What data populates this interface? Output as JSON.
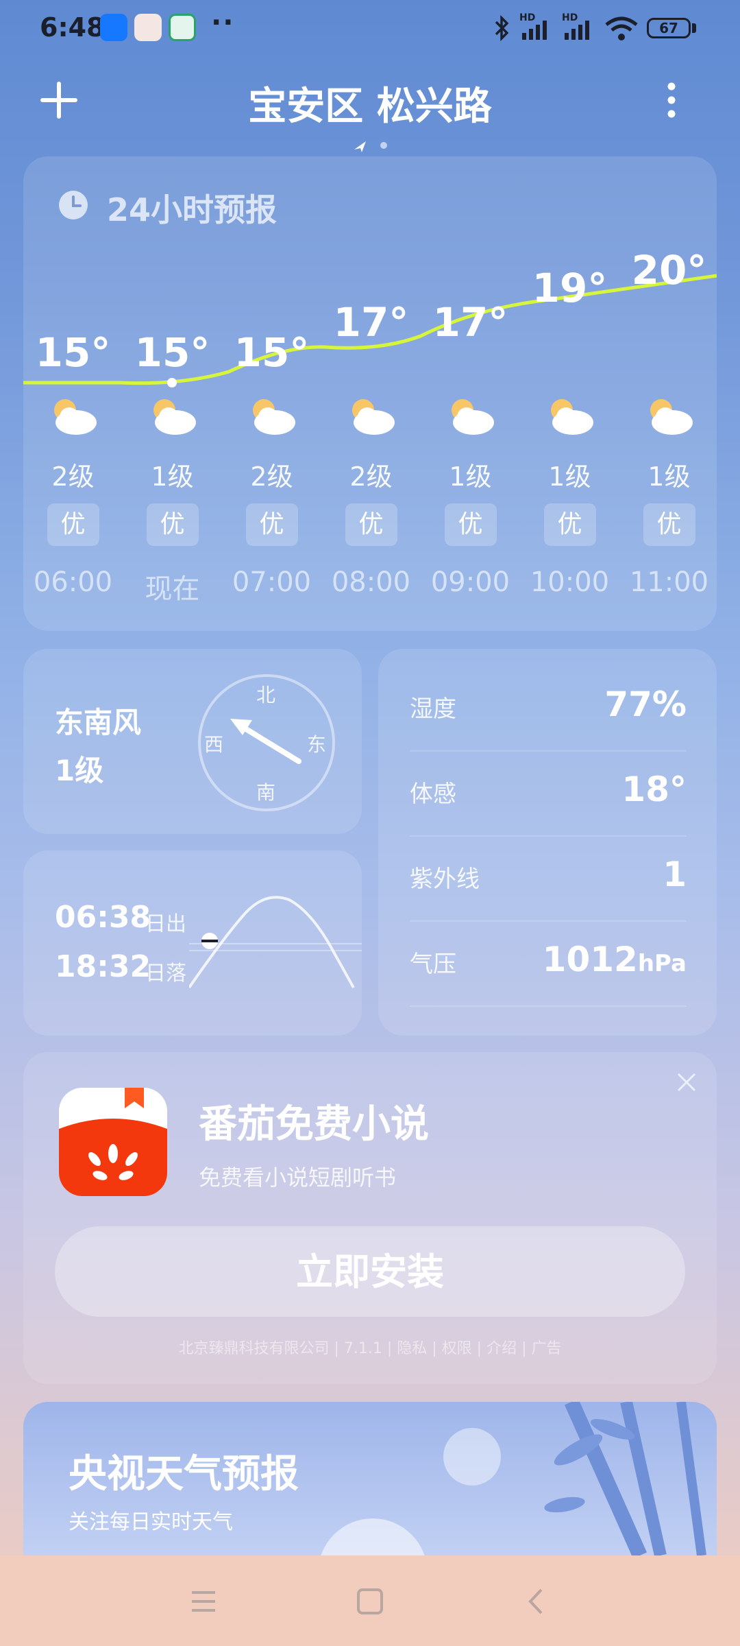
{
  "status_bar": {
    "time": "6:48",
    "battery": "67",
    "signal_label_1": "HD",
    "signal_label_2": "HD"
  },
  "header": {
    "location": "宝安区 松兴路"
  },
  "forecast": {
    "title": "24小时预报",
    "hours": [
      {
        "temp": "15°",
        "wind": "2级",
        "aqi": "优",
        "time": "06:00",
        "icon": "partly-cloudy-icon"
      },
      {
        "temp": "15°",
        "wind": "1级",
        "aqi": "优",
        "time": "现在",
        "icon": "partly-cloudy-icon"
      },
      {
        "temp": "15°",
        "wind": "2级",
        "aqi": "优",
        "time": "07:00",
        "icon": "partly-cloudy-icon"
      },
      {
        "temp": "17°",
        "wind": "2级",
        "aqi": "优",
        "time": "08:00",
        "icon": "partly-cloudy-icon"
      },
      {
        "temp": "17°",
        "wind": "1级",
        "aqi": "优",
        "time": "09:00",
        "icon": "partly-cloudy-icon"
      },
      {
        "temp": "19°",
        "wind": "1级",
        "aqi": "优",
        "time": "10:00",
        "icon": "partly-cloudy-icon"
      },
      {
        "temp": "20°",
        "wind": "1级",
        "aqi": "优",
        "time": "11:00",
        "icon": "partly-cloudy-icon"
      }
    ]
  },
  "wind": {
    "direction": "东南风",
    "level": "1级",
    "compass": {
      "n": "北",
      "e": "东",
      "s": "南",
      "w": "西"
    }
  },
  "sun": {
    "sunrise_time": "06:38",
    "sunrise_label": "日出",
    "sunset_time": "18:32",
    "sunset_label": "日落"
  },
  "details": [
    {
      "label": "湿度",
      "value": "77%",
      "unit": ""
    },
    {
      "label": "体感",
      "value": "18°",
      "unit": ""
    },
    {
      "label": "紫外线",
      "value": "1",
      "unit": ""
    },
    {
      "label": "气压",
      "value": "1012",
      "unit": "hPa"
    }
  ],
  "ad": {
    "title": "番茄免费小说",
    "subtitle": "免费看小说短剧听书",
    "button": "立即安装",
    "footer": "北京臻鼎科技有限公司 | 7.1.1 | 隐私 | 权限 | 介绍 | 广告"
  },
  "cctv": {
    "title": "央视天气预报",
    "subtitle": "关注每日实时天气"
  },
  "colors": {
    "temp_line": "#d7f53a",
    "bg_top": "#5f8ad2",
    "bg_bottom": "#f2cdbd"
  }
}
